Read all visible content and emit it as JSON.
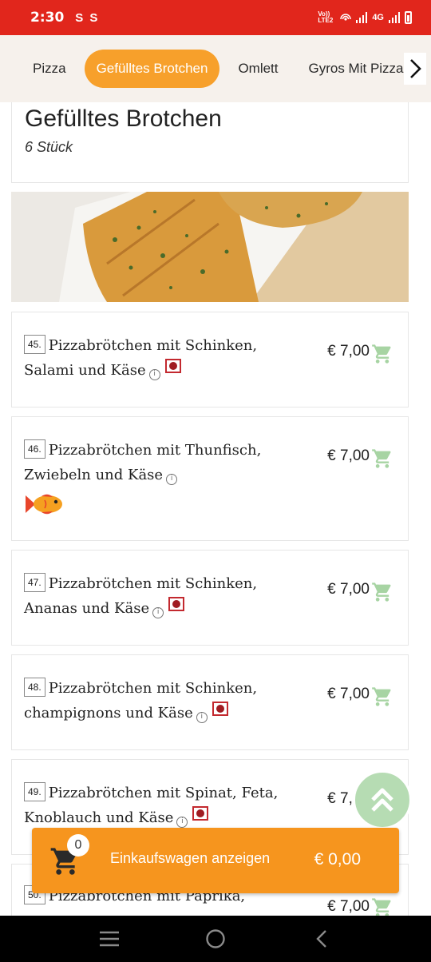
{
  "status_bar": {
    "time": "2:30",
    "network": "4G",
    "volte": "Vo)) LTE2"
  },
  "tabs": [
    {
      "label": "Pizza",
      "active": false
    },
    {
      "label": "Gefülltes Brotchen",
      "active": true
    },
    {
      "label": "Omlett",
      "active": false
    },
    {
      "label": "Gyros Mit Pizza",
      "active": false
    }
  ],
  "category": {
    "title": "Gefülltes Brotchen",
    "subtitle": "6 Stück",
    "banner_image": "stuffed-bread-photo"
  },
  "items": [
    {
      "number": "45.",
      "name": "Pizzabrötchen mit Schinken, Salami und Käse",
      "price": "€ 7,00",
      "tag": "meat-icon"
    },
    {
      "number": "46.",
      "name": "Pizzabrötchen mit Thunfisch, Zwiebeln und Käse",
      "price": "€ 7,00",
      "tag": "fish-icon"
    },
    {
      "number": "47.",
      "name": "Pizzabrötchen mit Schinken, Ananas und Käse",
      "price": "€ 7,00",
      "tag": "meat-icon"
    },
    {
      "number": "48.",
      "name": "Pizzabrötchen mit Schinken, champignons und Käse",
      "price": "€ 7,00",
      "tag": "meat-icon"
    },
    {
      "number": "49.",
      "name": "Pizzabrötchen mit Spinat, Feta, Knoblauch und Käse",
      "price": "€ 7,00",
      "tag": "meat-icon"
    },
    {
      "number": "50.",
      "name": "Pizzabrötchen mit Paprika,",
      "price": "€ 7,00",
      "tag": ""
    }
  ],
  "cart_bar": {
    "count": "0",
    "label": "Einkaufswagen anzeigen",
    "total": "€ 0,00"
  },
  "colors": {
    "status_bar": "#e1261c",
    "accent_orange": "#f7a02b",
    "cart_green": "#a7d4a3",
    "tab_bar_bg": "#f6f1ec"
  },
  "icons": {
    "cart": "cart-icon",
    "info": "info-icon",
    "scroll_top": "double-chevron-up-icon",
    "tab_next": "chevron-right-icon"
  }
}
